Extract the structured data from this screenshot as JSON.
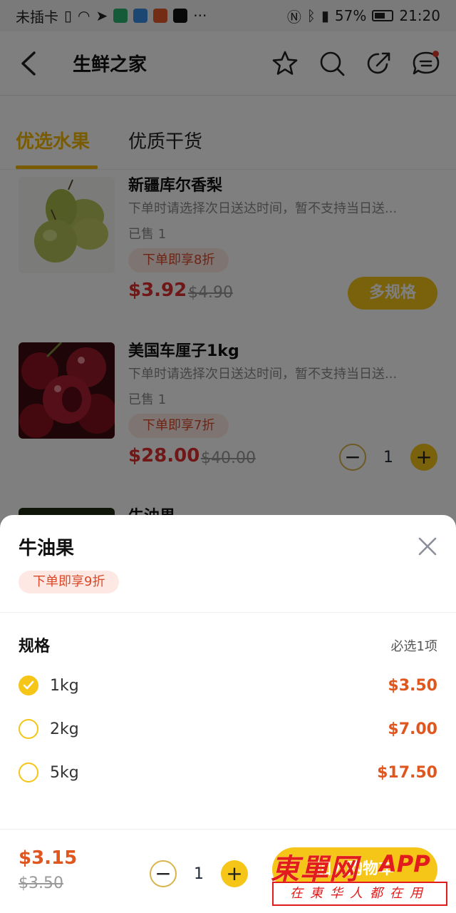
{
  "status_bar": {
    "carrier": "未插卡",
    "more": "···",
    "battery": "57%",
    "time": "21:20"
  },
  "header": {
    "title": "生鲜之家",
    "icons": [
      "back-arrow-icon",
      "star-icon",
      "search-icon",
      "share-icon",
      "message-icon"
    ]
  },
  "tabs": [
    {
      "label": "优选水果",
      "active": true
    },
    {
      "label": "优质干货",
      "active": false
    }
  ],
  "products": [
    {
      "name": "新疆库尔香梨",
      "desc": "下单时请选择次日送达时间，暂不支持当日送...",
      "sold": "已售 1",
      "discount": "下单即享8折",
      "price": "$3.92",
      "orig_price": "$4.90",
      "action": "多规格"
    },
    {
      "name": "美国车厘子1kg",
      "desc": "下单时请选择次日送达时间，暂不支持当日送...",
      "sold": "已售 1",
      "discount": "下单即享7折",
      "price": "$28.00",
      "orig_price": "$40.00",
      "quantity": "1"
    },
    {
      "name": "牛油果"
    }
  ],
  "sheet": {
    "title": "牛油果",
    "discount": "下单即享9折",
    "spec_label": "规格",
    "spec_required": "必选1项",
    "options": [
      {
        "name": "1kg",
        "price": "$3.50",
        "selected": true
      },
      {
        "name": "2kg",
        "price": "$7.00",
        "selected": false
      },
      {
        "name": "5kg",
        "price": "$17.50",
        "selected": false
      }
    ],
    "total_price": "$3.15",
    "total_orig": "$3.50",
    "quantity": "1",
    "add_button": "加入购物车"
  },
  "watermark": {
    "logo": "東單网",
    "app": "APP",
    "slogan": "在東华人都在用"
  },
  "colors": {
    "accent": "#f5c518",
    "price_red": "#e03030",
    "price_orange": "#e0561f",
    "discount_bg": "#fde8e4"
  }
}
